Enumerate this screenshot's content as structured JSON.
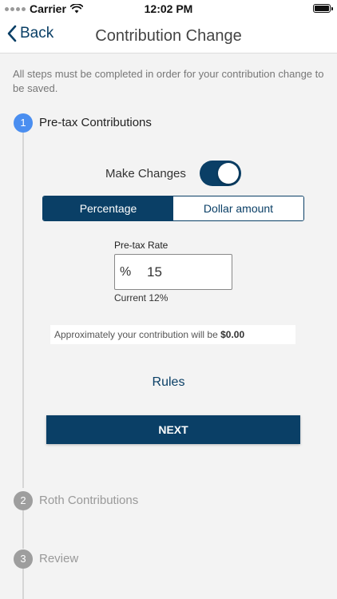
{
  "status_bar": {
    "carrier": "Carrier",
    "time": "12:02 PM"
  },
  "nav": {
    "back_label": "Back",
    "title": "Contribution Change"
  },
  "notice": "All steps must be completed in order for your contribution change to be saved.",
  "steps": [
    {
      "number": "1",
      "label": "Pre-tax Contributions",
      "state": "active"
    },
    {
      "number": "2",
      "label": "Roth Contributions",
      "state": "inactive"
    },
    {
      "number": "3",
      "label": "Review",
      "state": "inactive"
    }
  ],
  "form": {
    "make_changes_label": "Make Changes",
    "make_changes_on": true,
    "segments": [
      "Percentage",
      "Dollar amount"
    ],
    "selected_segment": "Percentage",
    "rate_label": "Pre-tax Rate",
    "rate_prefix": "%",
    "rate_value": "15",
    "current_rate": "Current 12%",
    "approx_text": "Approximately your contribution will be",
    "approx_amount": "$0.00",
    "rules_label": "Rules",
    "next_label": "NEXT"
  },
  "colors": {
    "primary": "#0a3f66",
    "active_step": "#4a8ef0",
    "inactive_step": "#9e9e9e",
    "background": "#f3f3f3"
  }
}
